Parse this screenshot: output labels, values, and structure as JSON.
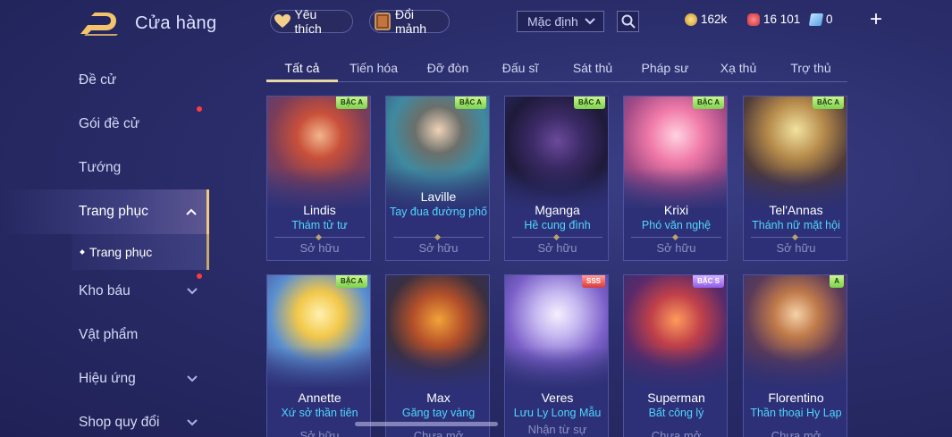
{
  "header": {
    "title": "Cửa hàng",
    "favorites_label": "Yêu thích",
    "exchange_label": "Đổi mảnh",
    "sort_value": "Mặc định",
    "currency_gold": "162k",
    "currency_gem": "16 101",
    "currency_voucher": "0",
    "plus_label": "+"
  },
  "sidebar": {
    "items": [
      {
        "label": "Đề cử"
      },
      {
        "label": "Gói đề cử"
      },
      {
        "label": "Tướng"
      },
      {
        "label": "Trang phục"
      },
      {
        "label": "Kho báu"
      },
      {
        "label": "Vật phẩm"
      },
      {
        "label": "Hiệu ứng"
      },
      {
        "label": "Shop quy đổi"
      }
    ],
    "sub_item": "Trang phục"
  },
  "tabs": [
    {
      "label": "Tất cả"
    },
    {
      "label": "Tiến hóa"
    },
    {
      "label": "Đỡ đòn"
    },
    {
      "label": "Đấu sĩ"
    },
    {
      "label": "Sát thủ"
    },
    {
      "label": "Pháp sư"
    },
    {
      "label": "Xạ thủ"
    },
    {
      "label": "Trợ thủ"
    }
  ],
  "cards": [
    {
      "hero": "Lindis",
      "skin": "Thám tử tư",
      "tier": "BẬC A",
      "status": "Sở hữu"
    },
    {
      "hero": "Laville",
      "skin": "Tay đua đường phố",
      "tier": "BẬC A",
      "status": "Sở hữu"
    },
    {
      "hero": "Mganga",
      "skin": "Hề cung đình",
      "tier": "BẬC A",
      "status": "Sở hữu"
    },
    {
      "hero": "Krixi",
      "skin": "Phó văn nghệ",
      "tier": "BẬC A",
      "status": "Sở hữu"
    },
    {
      "hero": "Tel'Annas",
      "skin": "Thánh nữ mặt hội",
      "tier": "BẬC A",
      "status": "Sở hữu"
    },
    {
      "hero": "Annette",
      "skin": "Xứ sở thần tiên",
      "tier": "BẬC A",
      "status": "Sở hữu"
    },
    {
      "hero": "Max",
      "skin": "Găng tay vàng",
      "tier": "",
      "status": "Chưa mở"
    },
    {
      "hero": "Veres",
      "skin": "Lưu Ly Long Mẫu",
      "tier": "SSS",
      "status": "Nhận từ sự"
    },
    {
      "hero": "Superman",
      "skin": "Bất công lý",
      "tier": "BẬC S",
      "status": "Chưa mở"
    },
    {
      "hero": "Florentino",
      "skin": "Thần thoại Hy Lạp",
      "tier": "A",
      "status": "Chưa mở"
    }
  ]
}
